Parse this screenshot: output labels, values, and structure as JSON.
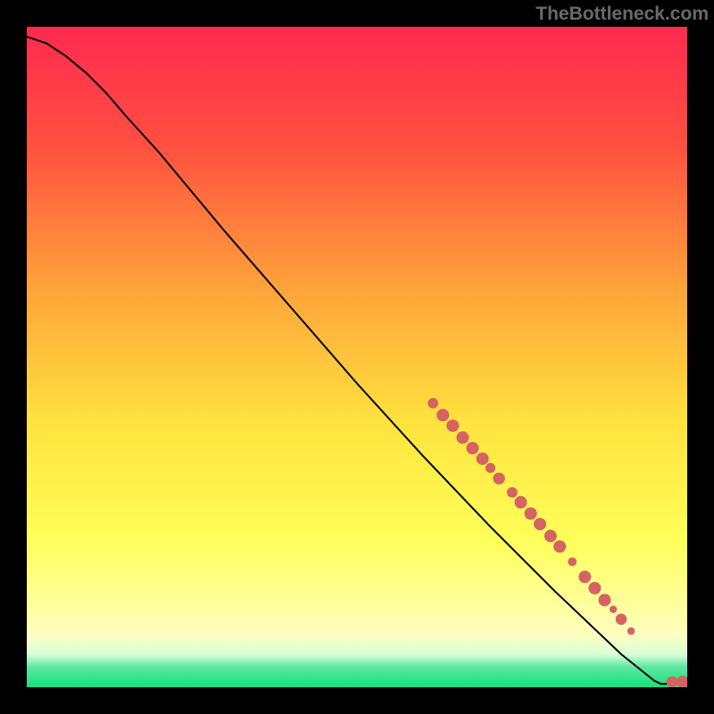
{
  "watermark": "TheBottleneck.com",
  "colors": {
    "bg_black": "#000000",
    "grad_top": "#ff2a4f",
    "grad_mid1": "#ff8a3a",
    "grad_mid2": "#ffe33e",
    "grad_yellow": "#ffff5a",
    "grad_paleyellow": "#ffffc0",
    "grad_palegreen": "#d9ffd9",
    "grad_mint": "#5ce6a0",
    "grad_green": "#18e07d",
    "curve": "#000000",
    "marker_fill": "#d56363",
    "marker_stroke": "#c04f4f"
  },
  "chart_data": {
    "type": "line",
    "title": "",
    "xlabel": "",
    "ylabel": "",
    "xlim": [
      0,
      100
    ],
    "ylim": [
      0,
      100
    ],
    "curve_points": [
      {
        "x": 0,
        "y": 98.5
      },
      {
        "x": 3,
        "y": 97.5
      },
      {
        "x": 6,
        "y": 95.5
      },
      {
        "x": 9,
        "y": 93.0
      },
      {
        "x": 12,
        "y": 90.0
      },
      {
        "x": 15,
        "y": 86.5
      },
      {
        "x": 20,
        "y": 81.0
      },
      {
        "x": 30,
        "y": 69.0
      },
      {
        "x": 40,
        "y": 57.5
      },
      {
        "x": 50,
        "y": 46.0
      },
      {
        "x": 60,
        "y": 35.0
      },
      {
        "x": 70,
        "y": 24.5
      },
      {
        "x": 80,
        "y": 14.5
      },
      {
        "x": 90,
        "y": 5.0
      },
      {
        "x": 95,
        "y": 1.0
      },
      {
        "x": 96,
        "y": 0.5
      },
      {
        "x": 97,
        "y": 0.5
      },
      {
        "x": 98.5,
        "y": 0.5
      },
      {
        "x": 100,
        "y": 0.5
      }
    ],
    "markers": [
      {
        "x": 61.5,
        "y": 43.0,
        "r": 4.2
      },
      {
        "x": 63.0,
        "y": 41.2,
        "r": 5.0
      },
      {
        "x": 64.5,
        "y": 39.6,
        "r": 5.0
      },
      {
        "x": 66.0,
        "y": 37.8,
        "r": 5.0
      },
      {
        "x": 67.5,
        "y": 36.2,
        "r": 5.0
      },
      {
        "x": 69.0,
        "y": 34.6,
        "r": 5.0
      },
      {
        "x": 70.2,
        "y": 33.2,
        "r": 4.0
      },
      {
        "x": 71.5,
        "y": 31.6,
        "r": 4.8
      },
      {
        "x": 73.5,
        "y": 29.5,
        "r": 4.2
      },
      {
        "x": 74.8,
        "y": 28.0,
        "r": 5.0
      },
      {
        "x": 76.3,
        "y": 26.3,
        "r": 5.0
      },
      {
        "x": 77.7,
        "y": 24.7,
        "r": 5.0
      },
      {
        "x": 79.3,
        "y": 22.9,
        "r": 5.0
      },
      {
        "x": 80.7,
        "y": 21.3,
        "r": 5.0
      },
      {
        "x": 82.6,
        "y": 19.0,
        "r": 3.5
      },
      {
        "x": 84.5,
        "y": 16.7,
        "r": 5.0
      },
      {
        "x": 86.0,
        "y": 15.0,
        "r": 5.0
      },
      {
        "x": 87.5,
        "y": 13.2,
        "r": 5.0
      },
      {
        "x": 88.8,
        "y": 11.8,
        "r": 3.0
      },
      {
        "x": 90.0,
        "y": 10.3,
        "r": 4.5
      },
      {
        "x": 91.5,
        "y": 8.5,
        "r": 3.0
      },
      {
        "x": 97.7,
        "y": 0.8,
        "r": 4.5
      },
      {
        "x": 99.3,
        "y": 0.8,
        "r": 5.0
      }
    ]
  }
}
